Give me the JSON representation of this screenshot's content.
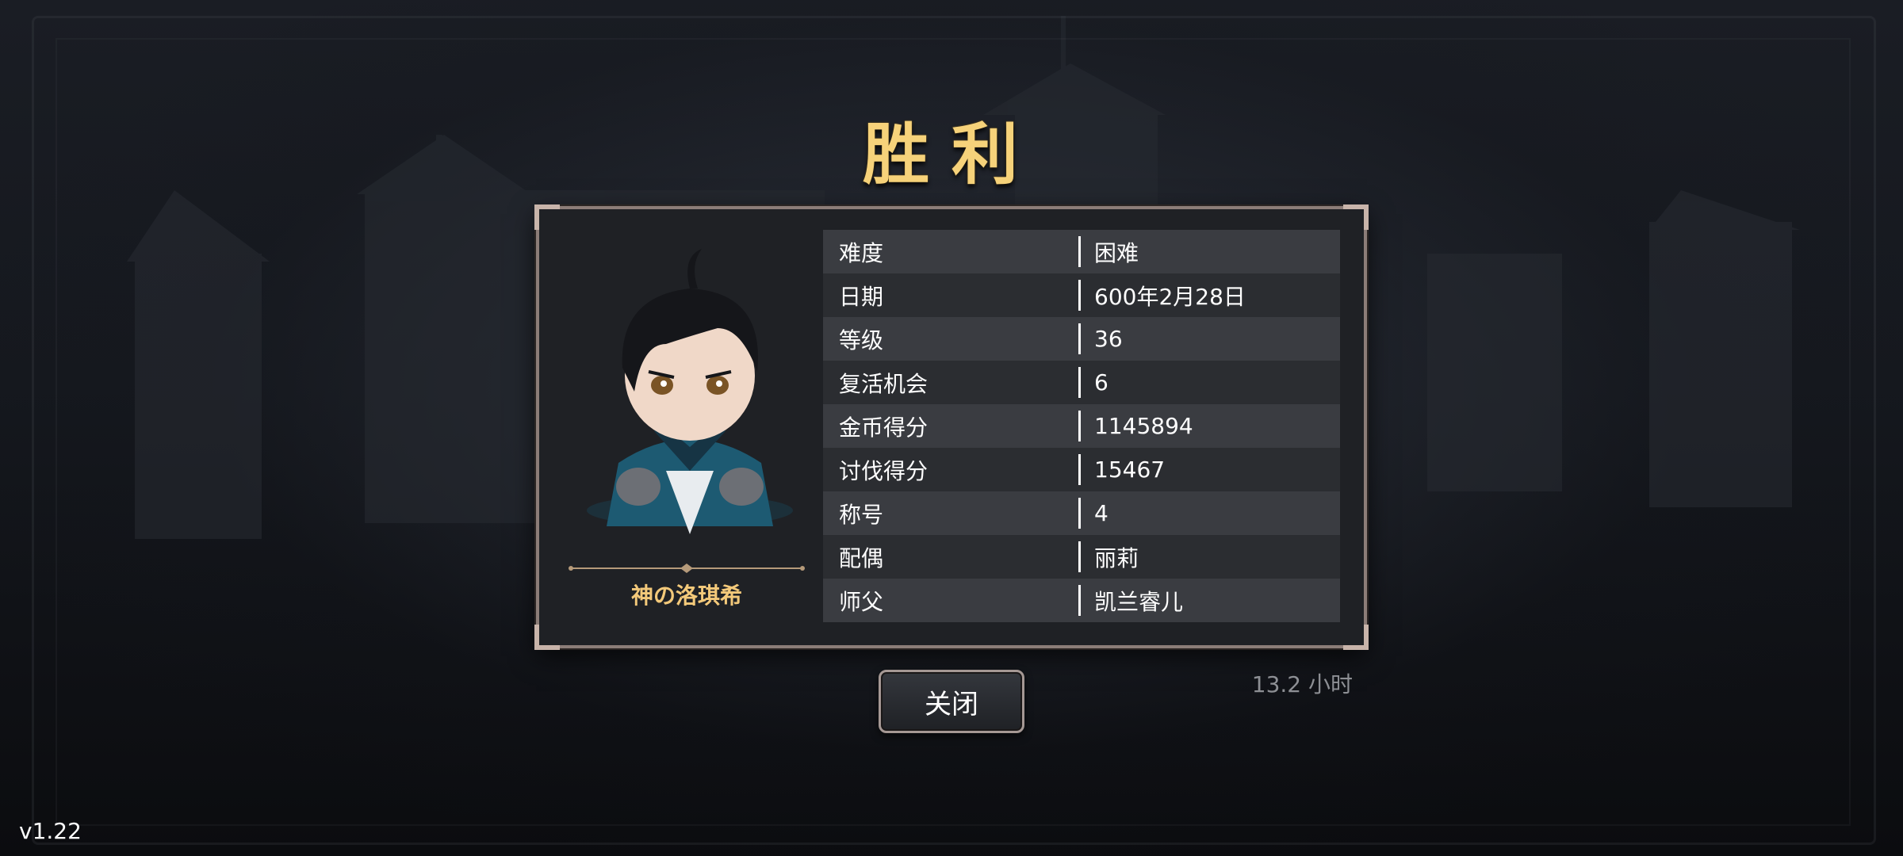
{
  "title": "胜利",
  "hero": {
    "name": "神の洛琪希"
  },
  "stats": [
    {
      "label": "难度",
      "value": "困难"
    },
    {
      "label": "日期",
      "value": "600年2月28日"
    },
    {
      "label": "等级",
      "value": "36"
    },
    {
      "label": "复活机会",
      "value": "6"
    },
    {
      "label": "金币得分",
      "value": "1145894"
    },
    {
      "label": "讨伐得分",
      "value": "15467"
    },
    {
      "label": "称号",
      "value": "4"
    },
    {
      "label": "配偶",
      "value": "丽莉"
    },
    {
      "label": "师父",
      "value": "凯兰睿儿"
    }
  ],
  "close_button": "关闭",
  "playtime": "13.2 小时",
  "version": "v1.22",
  "colors": {
    "title": "#f6d27a",
    "hero_name": "#f3c97a",
    "panel_border": "#8c7d78"
  }
}
